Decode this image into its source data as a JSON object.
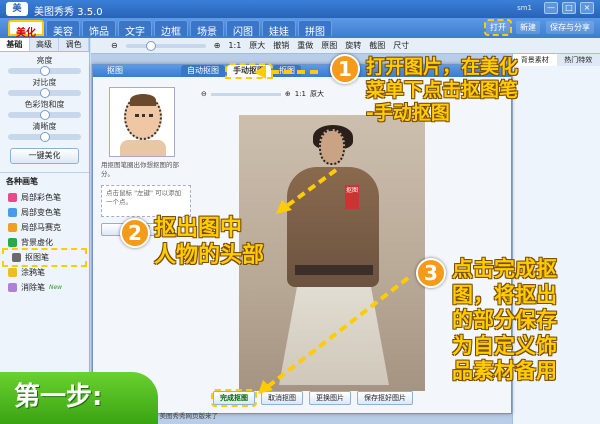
{
  "window": {
    "title": "美图秀秀 3.5.0",
    "logo": "美",
    "user": "sm1",
    "buttons": [
      "—",
      "□",
      "×"
    ]
  },
  "menu": {
    "tabs": [
      "美化",
      "美容",
      "饰品",
      "文字",
      "边框",
      "场景",
      "闪图",
      "娃娃",
      "拼图"
    ],
    "right": [
      "打开",
      "新建",
      "保存与分享"
    ]
  },
  "left": {
    "subtabs": [
      "基础",
      "高级",
      "调色"
    ],
    "sliders": [
      "亮度",
      "对比度",
      "色彩饱和度",
      "清晰度"
    ],
    "onekey": "一键美化",
    "brush_title": "各种画笔",
    "brushes": [
      "局部彩色笔",
      "局部变色笔",
      "局部马赛克",
      "背景虚化",
      "抠图笔",
      "涂鸦笔",
      "消除笔"
    ],
    "new_tag": "New",
    "brush_colors": [
      "#e84a8a",
      "#4a9ae8",
      "#f0a020",
      "#2aa84a",
      "#6a6a6a",
      "#e8c020",
      "#b080d8"
    ]
  },
  "toolbar": {
    "zoom": "1:1",
    "actual": "原大",
    "items": [
      "撤销",
      "重做",
      "原图",
      "旋转",
      "截图",
      "尺寸"
    ]
  },
  "dialog": {
    "title": "抠图",
    "tabs": [
      "自动抠图",
      "手动抠图",
      "抠图"
    ],
    "tip": "用抠图笔圈出你想抠图的部分。",
    "hint": "点击鼠标 \"左键\" 可以添加一个点。",
    "hint_btn": "抠图教程",
    "zoom": "1:1",
    "actual": "原大",
    "stamp": "抠图",
    "bottom": [
      "完成抠图",
      "取消抠图",
      "更换图片",
      "保存抠好图片"
    ]
  },
  "rightbar": {
    "tabs": [
      "背景素材",
      "热门特效"
    ]
  },
  "annotations": {
    "step1": [
      "打开图片，在美化",
      "菜单下点击抠图笔",
      "-手动抠图"
    ],
    "step2": [
      "抠出图中",
      "人物的头部"
    ],
    "step3": [
      "点击完成抠",
      "图，将抠出",
      "的部分保存",
      "为自定义饰",
      "品素材备用"
    ],
    "nums": [
      "1",
      "2",
      "3"
    ],
    "badge": "第一步:"
  },
  "status": "你好，美图秀秀网页版来了"
}
